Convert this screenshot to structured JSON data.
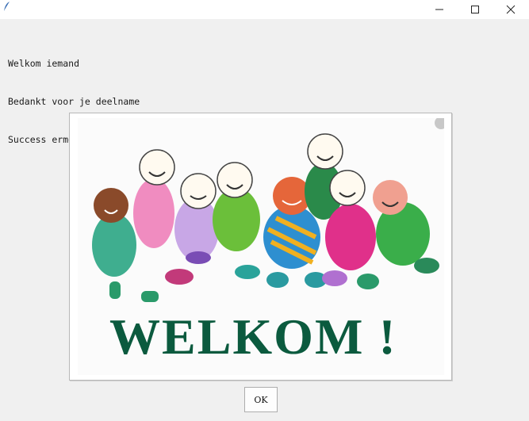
{
  "window": {
    "title": "",
    "controls": {
      "minimize": "minimize-icon",
      "maximize": "maximize-icon",
      "close": "close-icon"
    }
  },
  "message": {
    "lines": [
      "Welkom iemand",
      "Bedankt voor je deelname",
      "Success ermee"
    ]
  },
  "image": {
    "banner_text": "WELKOM !"
  },
  "dialog": {
    "ok_label": "OK"
  },
  "colors": {
    "background": "#f0f0f0",
    "banner_text": "#0b5a3e"
  }
}
